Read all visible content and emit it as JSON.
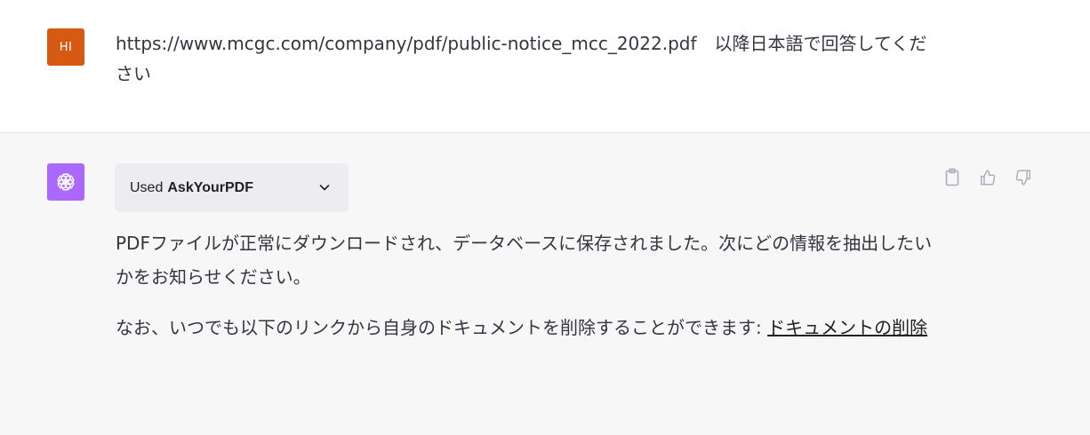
{
  "user_message": {
    "avatar_initials": "HI",
    "avatar_color": "#d65a12",
    "text": "https://www.mcgc.com/company/pdf/public-notice_mcc_2022.pdf　以降日本語で回答してください"
  },
  "assistant_message": {
    "avatar_color": "#ab68ff",
    "avatar_icon": "openai-logo-icon",
    "plugin": {
      "prefix": "Used",
      "name": "AskYourPDF",
      "chevron_icon": "chevron-down-icon"
    },
    "actions": {
      "copy_icon": "clipboard-icon",
      "thumbs_up_icon": "thumbs-up-icon",
      "thumbs_down_icon": "thumbs-down-icon"
    },
    "paragraph_1": "PDFファイルが正常にダウンロードされ、データベースに保存されました。次にどの情報を抽出したいかをお知らせください。",
    "paragraph_2_text": "なお、いつでも以下のリンクから自身のドキュメントを削除することができます: ",
    "paragraph_2_link": "ドキュメントの削除"
  }
}
